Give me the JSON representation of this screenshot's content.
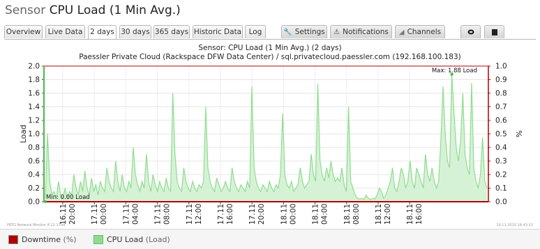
{
  "page": {
    "title_prefix": "Sensor",
    "title_main": "CPU Load (1 Min Avg.)"
  },
  "tabs": [
    {
      "label": "Overview",
      "active": false
    },
    {
      "label": "Live Data",
      "active": false
    },
    {
      "label": "2 days",
      "active": true
    },
    {
      "label": "30 days",
      "active": false
    },
    {
      "label": "365 days",
      "active": false
    },
    {
      "label": "Historic Data",
      "active": false
    },
    {
      "label": "Log",
      "active": false
    },
    {
      "label": "Settings",
      "icon": "wrench-icon"
    },
    {
      "label": "Notifications",
      "icon": "warning-icon"
    },
    {
      "label": "Channels",
      "icon": "chart-icon"
    },
    {
      "label": "",
      "icon": "comment-icon"
    },
    {
      "label": "",
      "icon": "stop-icon"
    }
  ],
  "chart": {
    "title_line1": "Sensor: CPU Load (1 Min Avg.) (2 days)",
    "title_line2": "Paessler Private Cloud (Rackspace DFW Data Center) / sql.privatecloud.paessler.com (192.168.100.183)",
    "footer_left": "PRTG Network Monitor 8.12.1799",
    "footer_right": "19.11.2010 16:43:13"
  },
  "chart_data": {
    "type": "area",
    "ylabel_left": "Load",
    "ylabel_right": "%",
    "ylim_left": [
      0,
      2.0
    ],
    "ylim_right": [
      0,
      1.0
    ],
    "yticks_left": [
      "0.0",
      "0.2",
      "0.4",
      "0.6",
      "0.8",
      "1.0",
      "1.2",
      "1.4",
      "1.6",
      "1.8",
      "2.0"
    ],
    "yticks_right": [
      "0.0",
      "0.1",
      "0.2",
      "0.3",
      "0.4",
      "0.5",
      "0.6",
      "0.7",
      "0.8",
      "0.9",
      "1.0"
    ],
    "xticks": [
      {
        "date": "16.11",
        "time": "20:00"
      },
      {
        "date": "17.11",
        "time": "00:00"
      },
      {
        "date": "17.11",
        "time": "04:00"
      },
      {
        "date": "17.11",
        "time": "08:00"
      },
      {
        "date": "17.11",
        "time": "12:00"
      },
      {
        "date": "17.11",
        "time": "16:00"
      },
      {
        "date": "17.11",
        "time": "20:00"
      },
      {
        "date": "18.11",
        "time": "00:00"
      },
      {
        "date": "18.11",
        "time": "04:00"
      },
      {
        "date": "18.11",
        "time": "08:00"
      },
      {
        "date": "18.11",
        "time": "12:00"
      },
      {
        "date": "18.11",
        "time": "16:00"
      }
    ],
    "annotations": {
      "min": "Min: 0.00 Load",
      "max": "Max: 1.88 Load"
    },
    "series": [
      {
        "name": "CPU Load",
        "color": "#8fdc8f",
        "values": [
          0.05,
          1.0,
          0.3,
          0.1,
          0.15,
          0.05,
          0.3,
          0.1,
          0.05,
          0.2,
          0.05,
          0.15,
          0.1,
          0.4,
          0.2,
          0.1,
          0.3,
          0.15,
          0.45,
          0.2,
          0.1,
          0.35,
          0.15,
          0.25,
          0.1,
          0.3,
          0.2,
          0.15,
          0.5,
          0.3,
          0.2,
          0.15,
          0.6,
          0.3,
          0.15,
          0.4,
          0.2,
          0.15,
          0.3,
          0.2,
          0.8,
          0.4,
          0.25,
          0.15,
          0.3,
          0.2,
          0.7,
          0.3,
          0.15,
          0.4,
          0.25,
          0.15,
          0.3,
          0.2,
          0.15,
          0.35,
          0.2,
          0.15,
          1.6,
          0.7,
          0.3,
          0.2,
          0.15,
          0.5,
          0.3,
          0.2,
          0.15,
          0.3,
          0.2,
          0.15,
          0.25,
          0.2,
          0.3,
          1.4,
          0.5,
          0.3,
          0.2,
          0.15,
          0.35,
          0.25,
          0.15,
          0.2,
          0.3,
          0.2,
          0.15,
          0.5,
          0.3,
          0.2,
          0.15,
          0.25,
          0.2,
          0.15,
          0.3,
          0.2,
          1.7,
          0.5,
          0.3,
          0.2,
          0.15,
          0.25,
          0.2,
          0.15,
          0.3,
          0.2,
          0.15,
          0.25,
          0.2,
          0.4,
          1.3,
          0.4,
          0.25,
          0.2,
          0.3,
          0.15,
          0.2,
          0.25,
          0.5,
          0.3,
          0.2,
          0.25,
          0.3,
          0.7,
          0.4,
          0.3,
          1.74,
          0.6,
          0.4,
          0.3,
          0.5,
          0.35,
          0.6,
          0.4,
          0.3,
          0.35,
          0.3,
          0.5,
          0.25,
          0.15,
          1.4,
          0.3,
          0.2,
          0.1,
          0.05,
          0.04,
          0.05,
          0.03,
          0.1,
          0.05,
          0.03,
          0.05,
          0.04,
          0.1,
          0.2,
          0.15,
          0.05,
          0.1,
          0.2,
          0.3,
          0.5,
          0.2,
          0.15,
          0.3,
          0.5,
          0.4,
          0.2,
          0.3,
          0.6,
          0.3,
          0.2,
          0.5,
          0.4,
          0.3,
          0.2,
          0.7,
          0.4,
          0.3,
          0.5,
          0.3,
          0.2,
          0.3,
          0.9,
          1.7,
          1.0,
          0.6,
          0.5,
          1.88,
          1.3,
          0.8,
          0.6,
          0.9,
          1.6,
          0.7,
          0.5,
          0.4,
          1.75,
          0.5,
          0.3,
          0.2,
          0.4,
          0.95,
          0.3,
          0.2
        ]
      },
      {
        "name": "Downtime",
        "color": "#b00000",
        "values": [
          0,
          0
        ]
      }
    ]
  },
  "legend": [
    {
      "label": "Downtime",
      "unit": "(%)",
      "color": "#b00000"
    },
    {
      "label": "CPU Load",
      "unit": "(Load)",
      "color": "#8fdc8f"
    }
  ]
}
